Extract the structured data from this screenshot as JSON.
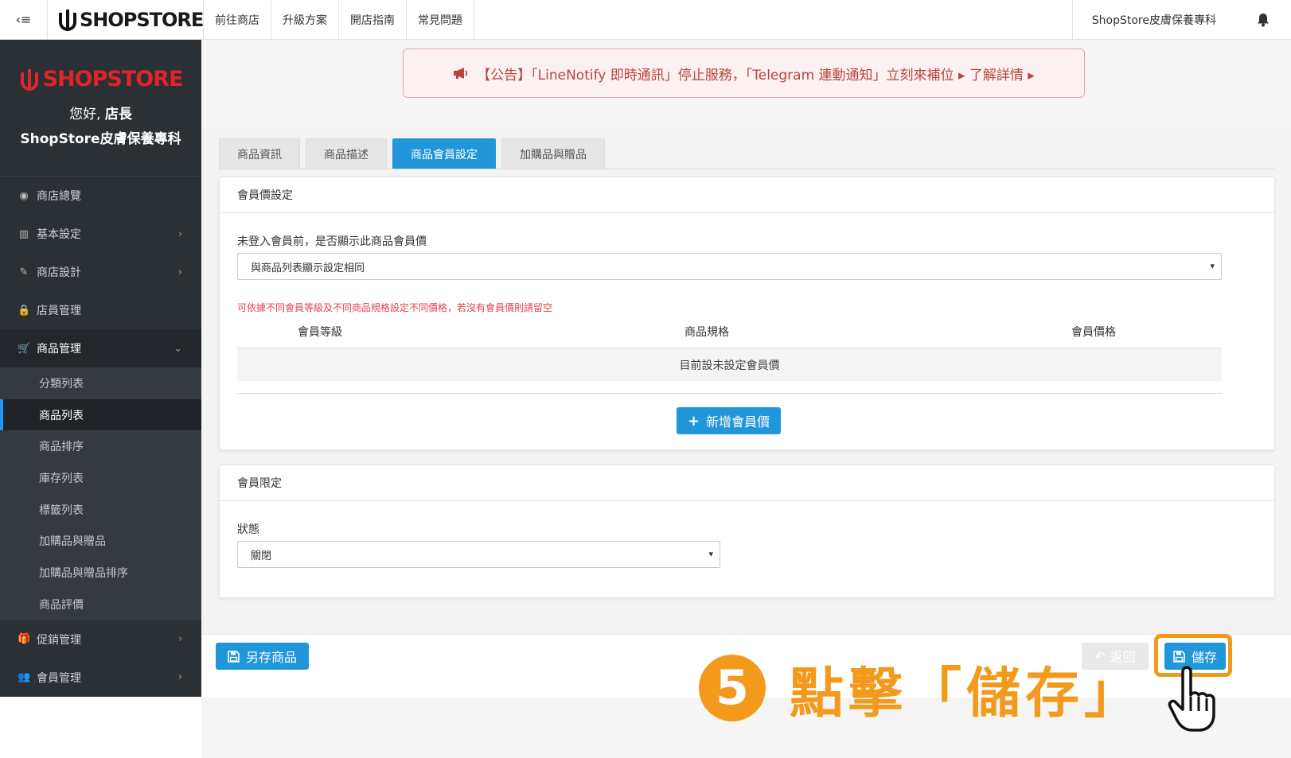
{
  "topbar": {
    "toggle_icon": "‹≡",
    "logo_text": "SHOPSTORE",
    "nav": [
      "前往商店",
      "升級方案",
      "開店指南",
      "常見問題"
    ],
    "store_name": "ShopStore皮膚保養專科"
  },
  "sidebar": {
    "brand_logo": "SHOPSTORE",
    "hello_prefix": "您好,",
    "hello_name": "店長",
    "store_name": "ShopStore皮膚保養專科",
    "items": [
      {
        "label": "商店總覽",
        "icon": "dashboard-icon",
        "glyph": "◉"
      },
      {
        "label": "基本設定",
        "icon": "bank-icon",
        "glyph": "▥"
      },
      {
        "label": "商店設計",
        "icon": "magic-wand-icon",
        "glyph": "✎"
      },
      {
        "label": "店員管理",
        "icon": "lock-icon",
        "glyph": "🔒"
      },
      {
        "label": "商品管理",
        "icon": "cart-icon",
        "glyph": "🛒"
      }
    ],
    "sub_items": [
      "分類列表",
      "商品列表",
      "商品排序",
      "庫存列表",
      "標籤列表",
      "加購品與贈品",
      "加購品與贈品排序",
      "商品評價"
    ],
    "bottom_items": [
      {
        "label": "促銷管理",
        "icon": "gift-icon",
        "glyph": "🎁"
      },
      {
        "label": "會員管理",
        "icon": "users-icon",
        "glyph": "👥"
      }
    ]
  },
  "notice": {
    "text": "【公告】「LineNotify 即時通訊」停止服務，「Telegram 連動通知」立刻來補位 ▸ 了解詳情 ▸"
  },
  "tabs": [
    "商品資訊",
    "商品描述",
    "商品會員設定",
    "加購品與贈品"
  ],
  "member_price": {
    "title": "會員價設定",
    "field_label": "未登入會員前，是否顯示此商品會員價",
    "select_value": "與商品列表顯示設定相同",
    "hint": "可依據不同會員等級及不同商品規格設定不同價格，若沒有會員價則請留空",
    "columns": [
      "會員等級",
      "商品規格",
      "會員價格"
    ],
    "empty_text": "目前設未設定會員價",
    "add_button": "新增會員價"
  },
  "member_limit": {
    "title": "會員限定",
    "field_label": "狀態",
    "select_value": "關閉"
  },
  "bottom": {
    "save_as_label": "另存商品",
    "back_label": "返回",
    "save_label": "儲存"
  },
  "annotation": {
    "step": "5",
    "text": "點擊「儲存」"
  },
  "colors": {
    "accent": "#2196d9",
    "sidebar_bg": "#2b3035",
    "brand_red": "#e0242b",
    "annotation_orange": "#f39a1d",
    "notice_text": "#b5473e"
  }
}
